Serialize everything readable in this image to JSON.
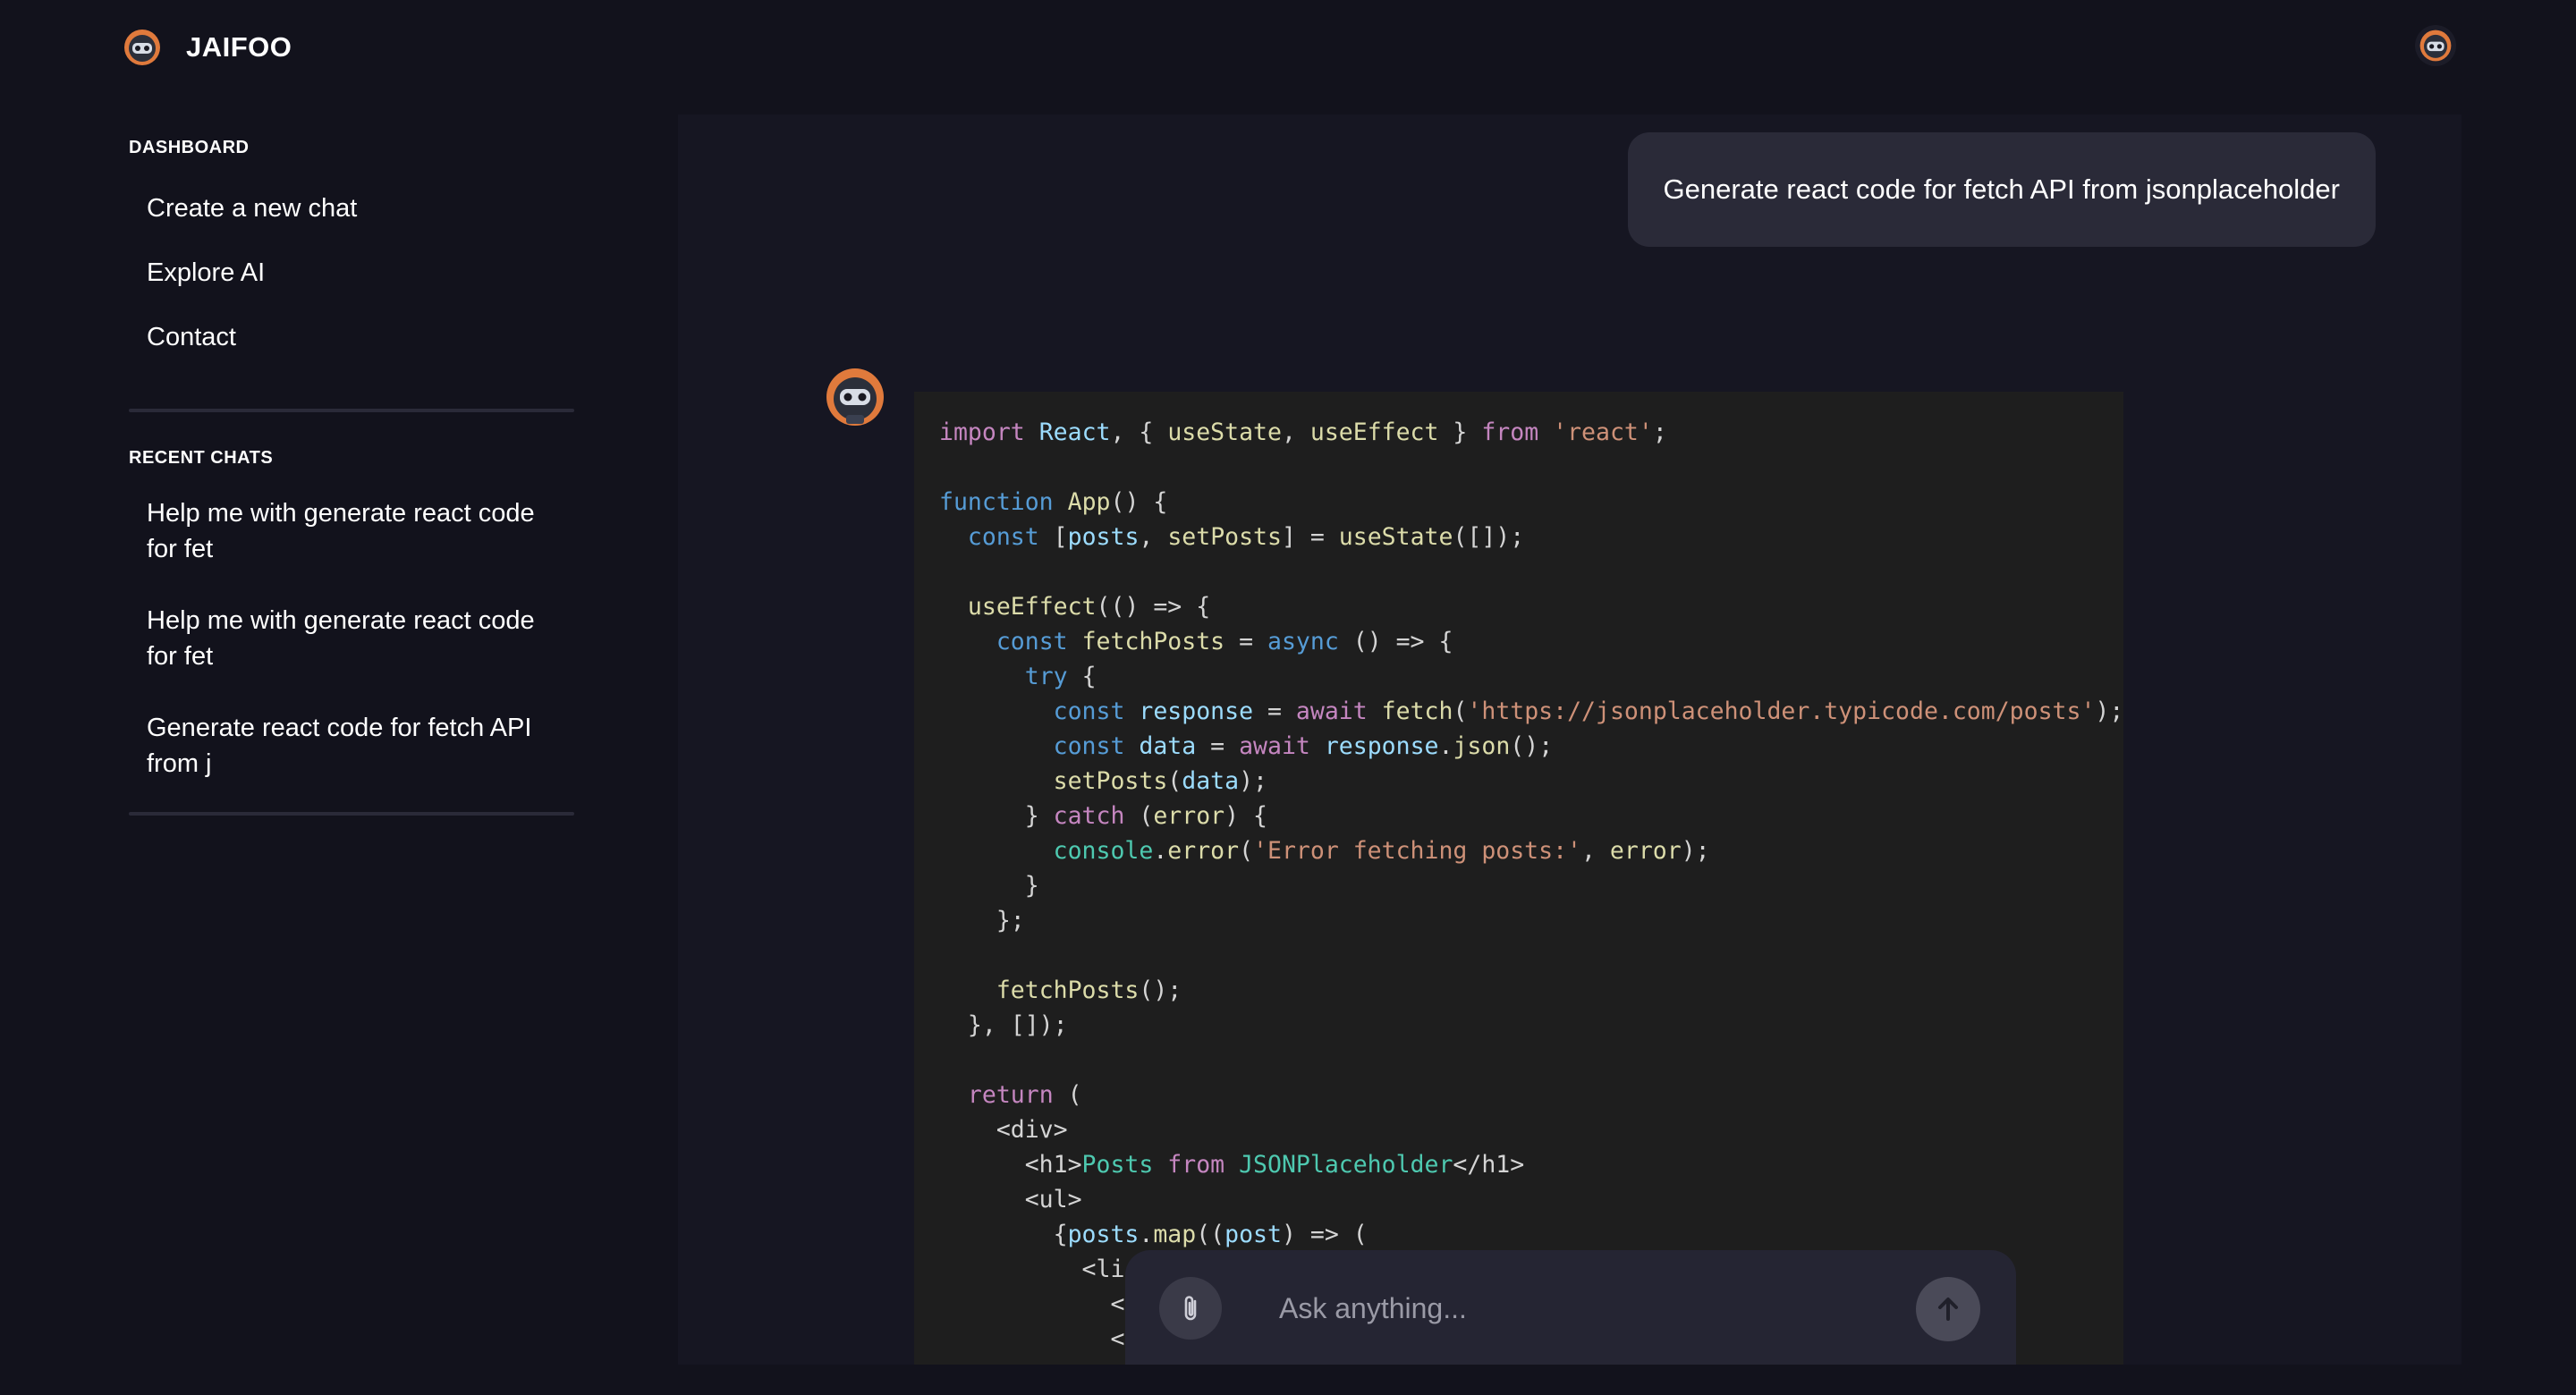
{
  "header": {
    "brand_name": "JAIFOO",
    "logo_icon": "robot-mascot-icon",
    "user_avatar_icon": "robot-mascot-icon"
  },
  "sidebar": {
    "dashboard_title": "DASHBOARD",
    "nav_items": [
      {
        "label": "Create a new chat"
      },
      {
        "label": "Explore AI"
      },
      {
        "label": "Contact"
      }
    ],
    "recent_title": "RECENT CHATS",
    "recent_chats": [
      {
        "label": "Help me with generate react code for fet"
      },
      {
        "label": "Help me with generate react code for fet"
      },
      {
        "label": "Generate react code for fetch API from j"
      }
    ]
  },
  "chat": {
    "user_message": "Generate react code for fetch API from jsonplaceholder",
    "bot_avatar_icon": "robot-mascot-icon",
    "code_lines": [
      "import React, { useState, useEffect } from 'react';",
      "",
      "function App() {",
      "  const [posts, setPosts] = useState([]);",
      "",
      "  useEffect(() => {",
      "    const fetchPosts = async () => {",
      "      try {",
      "        const response = await fetch('https://jsonplaceholder.typicode.com/posts');",
      "        const data = await response.json();",
      "        setPosts(data);",
      "      } catch (error) {",
      "        console.error('Error fetching posts:', error);",
      "      }",
      "    };",
      "",
      "    fetchPosts();",
      "  }, []);",
      "",
      "  return (",
      "    <div>",
      "      <h1>Posts from JSONPlaceholder</h1>",
      "      <ul>",
      "        {posts.map((post) => (",
      "          <li",
      "            <",
      "            <",
      "          <"
    ]
  },
  "composer": {
    "placeholder": "Ask anything...",
    "attach_icon": "paperclip-icon",
    "send_icon": "arrow-up-icon"
  },
  "colors": {
    "page_bg": "#12121c",
    "panel_bg": "#161622",
    "bubble_bg": "#2a2a38",
    "code_bg": "#1e1e1e",
    "composer_bg": "#252533",
    "accent_orange": "#e07a3c"
  }
}
